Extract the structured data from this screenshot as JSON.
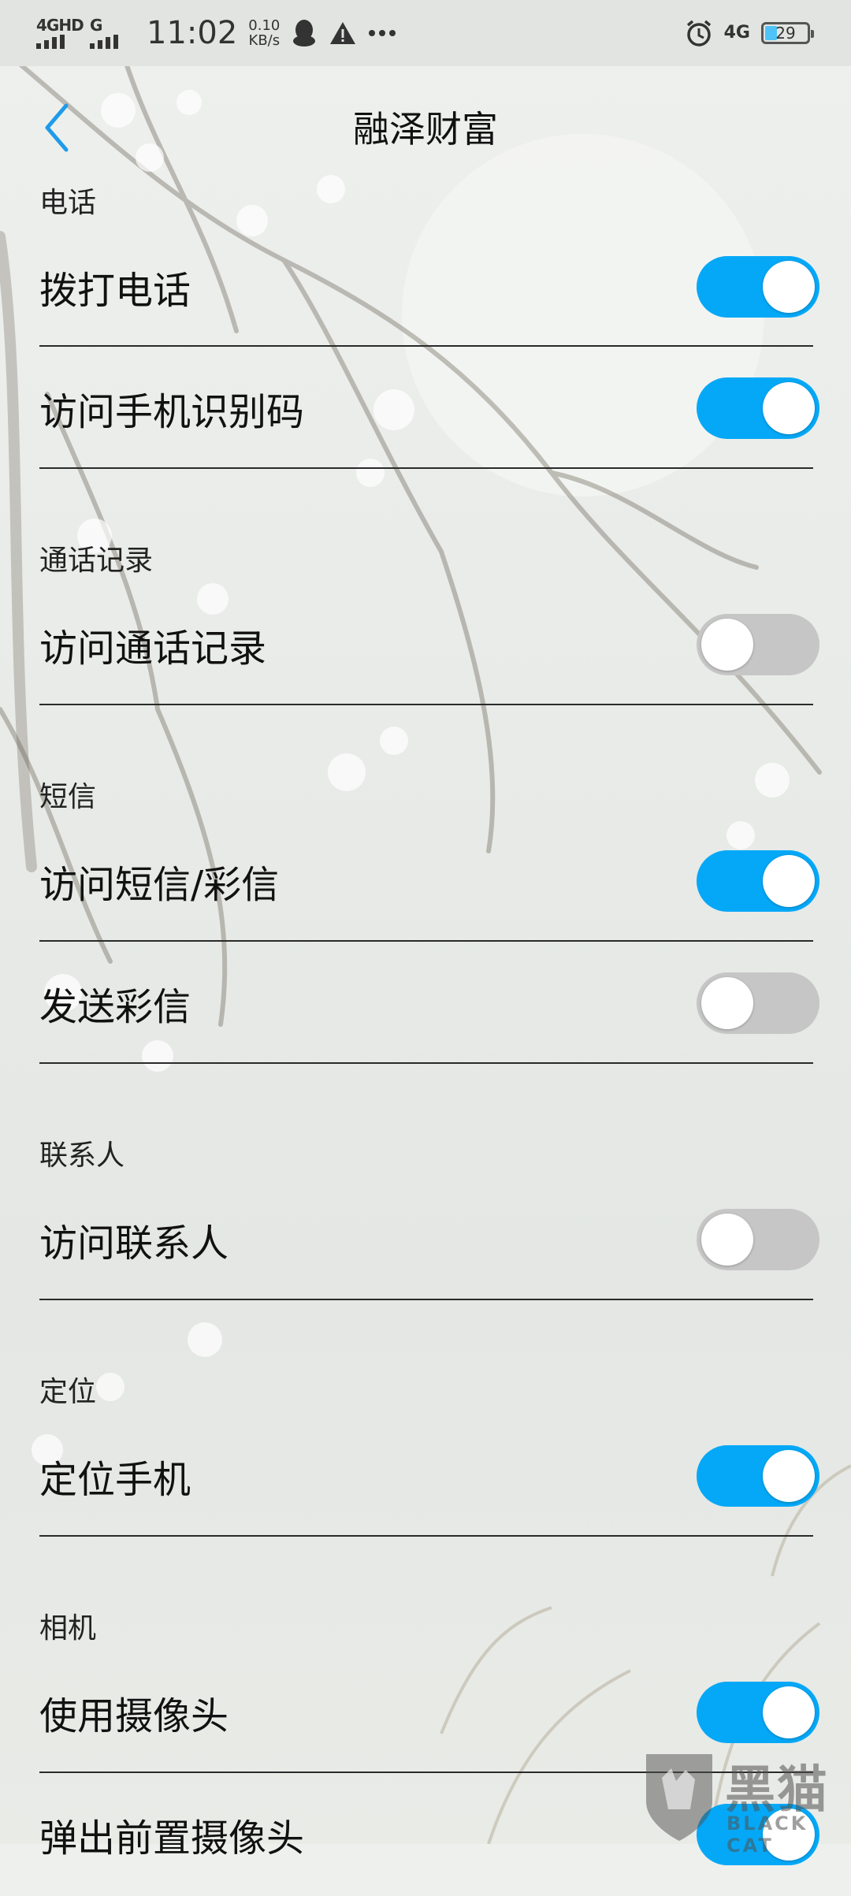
{
  "status_bar": {
    "network_primary": "4GHD",
    "network_secondary": "G",
    "time": "11:02",
    "speed_value": "0.10",
    "speed_unit": "KB/s",
    "right_network": "4G",
    "battery_level": "29",
    "battery_fraction": 0.29,
    "icons": [
      "qq-icon",
      "alert-triangle-icon",
      "more-dots-icon",
      "alarm-icon"
    ]
  },
  "header": {
    "title": "融泽财富",
    "back_icon": "chevron-left-icon"
  },
  "sections": [
    {
      "title": "电话",
      "items": [
        {
          "label": "拨打电话",
          "enabled": true
        },
        {
          "label": "访问手机识别码",
          "enabled": true
        }
      ]
    },
    {
      "title": "通话记录",
      "items": [
        {
          "label": "访问通话记录",
          "enabled": false
        }
      ]
    },
    {
      "title": "短信",
      "items": [
        {
          "label": "访问短信/彩信",
          "enabled": true
        },
        {
          "label": "发送彩信",
          "enabled": false
        }
      ]
    },
    {
      "title": "联系人",
      "items": [
        {
          "label": "访问联系人",
          "enabled": false
        }
      ]
    },
    {
      "title": "定位",
      "items": [
        {
          "label": "定位手机",
          "enabled": true
        }
      ]
    },
    {
      "title": "相机",
      "items": [
        {
          "label": "使用摄像头",
          "enabled": true
        },
        {
          "label": "弹出前置摄像头",
          "enabled": true
        }
      ]
    }
  ],
  "watermark": {
    "text_cn": "黑猫",
    "text_en": "BLACK CAT"
  },
  "colors": {
    "toggle_on": "#05a8f7",
    "toggle_off": "#c6c6c6",
    "back_arrow": "#1e9be9"
  }
}
